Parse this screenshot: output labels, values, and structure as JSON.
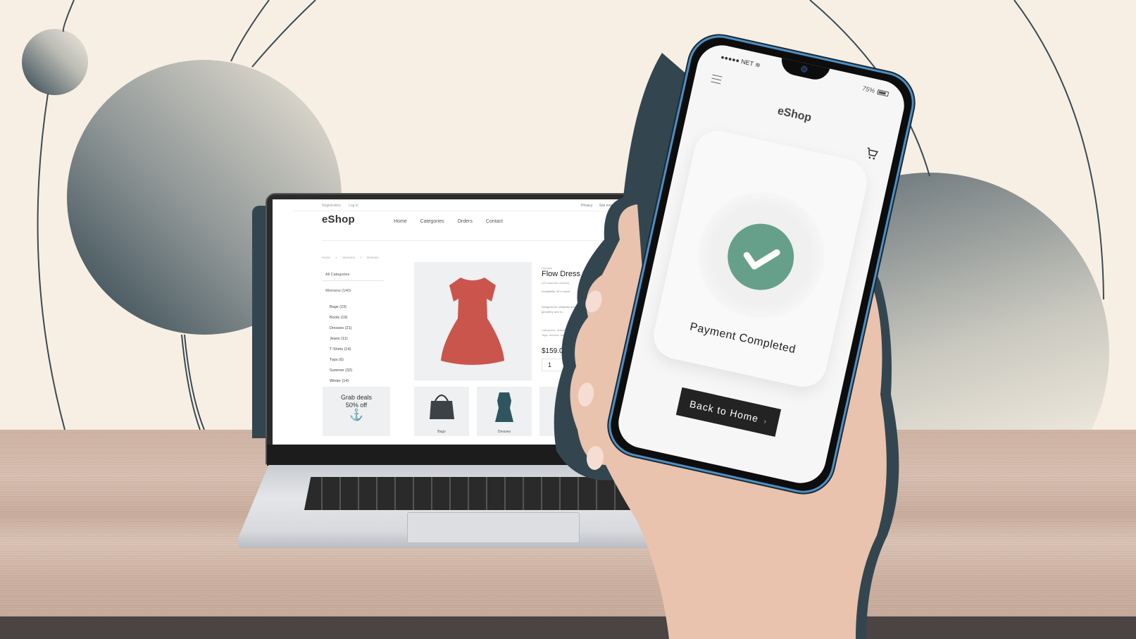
{
  "colors": {
    "background": "#f7efe3",
    "accent_dark": "#334650",
    "success": "#67a08a",
    "button": "#232323",
    "phone_frame": "#4b8fc4"
  },
  "laptop": {
    "top_links": [
      "Registration",
      "Log in"
    ],
    "top_right_links": [
      "Privacy",
      "Site map"
    ],
    "logo": "eShop",
    "nav": [
      "Home",
      "Categories",
      "Orders",
      "Contact"
    ],
    "breadcrumb": [
      "Home",
      ">",
      "Womens",
      ">",
      "Dresses"
    ],
    "sidebar": {
      "all_categories": "All Categories",
      "group": "Womens (140)",
      "items": [
        "Bags (23)",
        "Boots (19)",
        "Dresses (21)",
        "Jeans (11)",
        "T-Shirts (14)",
        "Tops (6)",
        "Summer (32)",
        "Winter (14)"
      ]
    },
    "promo": {
      "line1": "Grab deals",
      "line2": "50% off",
      "icon": "anchor-icon"
    },
    "product": {
      "category": "Dresses",
      "title": "Flow Dress Red",
      "reviews": "(23 customer reviews)",
      "availability": "Availability: 35 in stock",
      "description": "Designed for simplicity and its sleek geometry and m...",
      "categories": "Categories: Dresses, ...",
      "tags": "Tags: dresses, fashio...",
      "price": "$159.00",
      "quantity": "1"
    },
    "tiles": [
      {
        "label": "Bags",
        "icon": "handbag-icon"
      },
      {
        "label": "Dresses",
        "icon": "dress-icon"
      }
    ]
  },
  "phone": {
    "status_left": "●●●●● NET",
    "battery": "75%",
    "battery_level": 0.75,
    "app_title": "eShop",
    "message": "Payment Completed",
    "button_label": "Back to Home",
    "button_chevron": "›"
  }
}
